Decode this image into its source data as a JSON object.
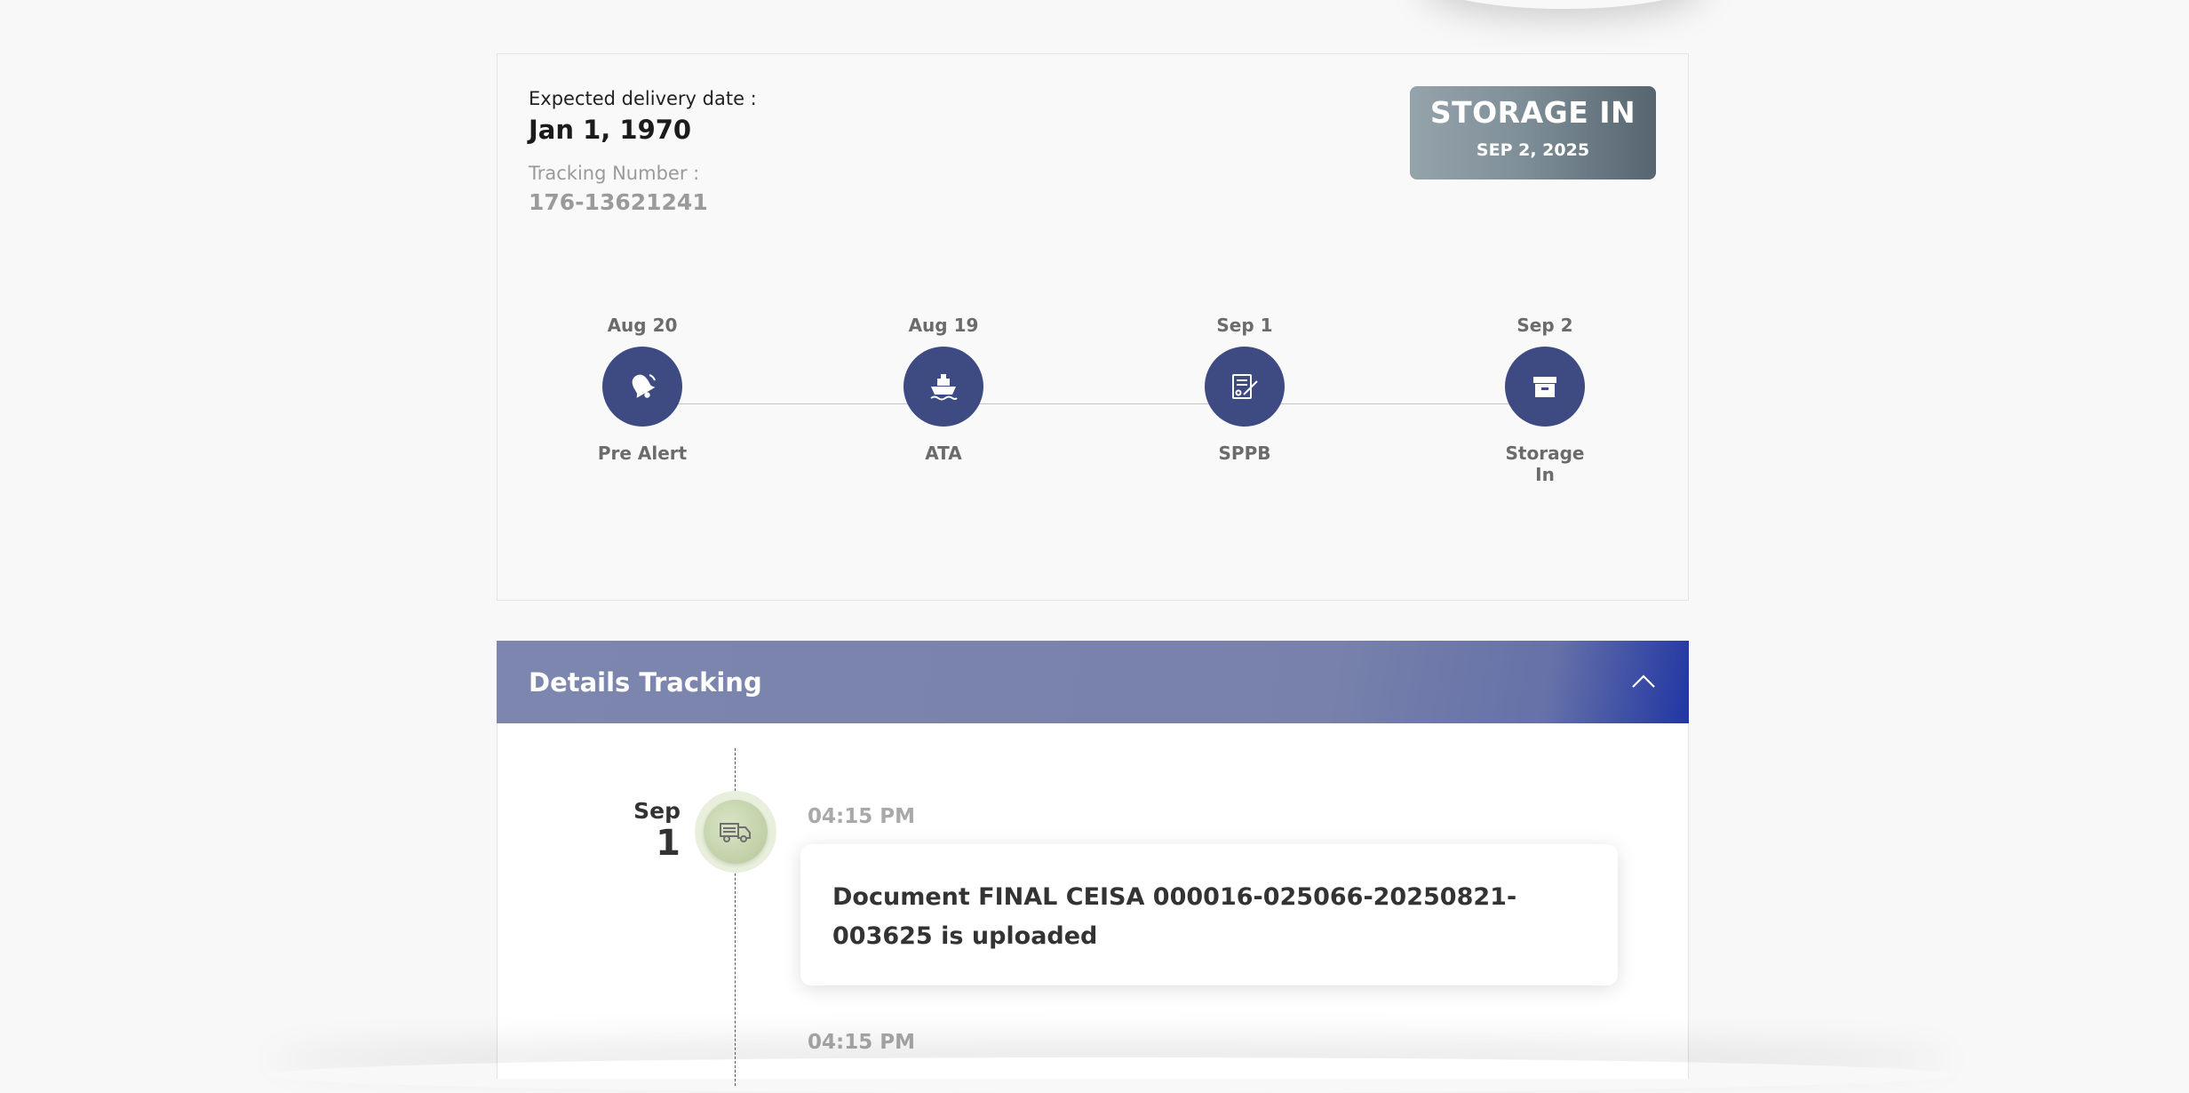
{
  "summary": {
    "expected_label": "Expected delivery date :",
    "expected_value": "Jan 1, 1970",
    "tracking_label": "Tracking Number :",
    "tracking_value": "176-13621241"
  },
  "status_badge": {
    "title": "STORAGE IN",
    "date": "SEP 2, 2025"
  },
  "steps": [
    {
      "date": "Aug 20",
      "label": "Pre Alert",
      "icon": "bell-icon"
    },
    {
      "date": "Aug 19",
      "label": "ATA",
      "icon": "ship-icon"
    },
    {
      "date": "Sep 1",
      "label": "SPPB",
      "icon": "document-sign-icon"
    },
    {
      "date": "Sep 2",
      "label": "Storage\nIn",
      "icon": "archive-box-icon"
    }
  ],
  "details": {
    "title": "Details Tracking",
    "toggle_icon": "chevron-up-icon"
  },
  "events": [
    {
      "month": "Sep",
      "day": "1",
      "time": "04:15 PM",
      "icon": "truck-icon",
      "message": "Document FINAL CEISA 000016-025066-20250821-003625 is uploaded"
    },
    {
      "time": "04:15 PM"
    }
  ],
  "colors": {
    "step_circle": "#3e4a82",
    "header_accent": "#2136a3",
    "badge_dark": "#56656f"
  }
}
